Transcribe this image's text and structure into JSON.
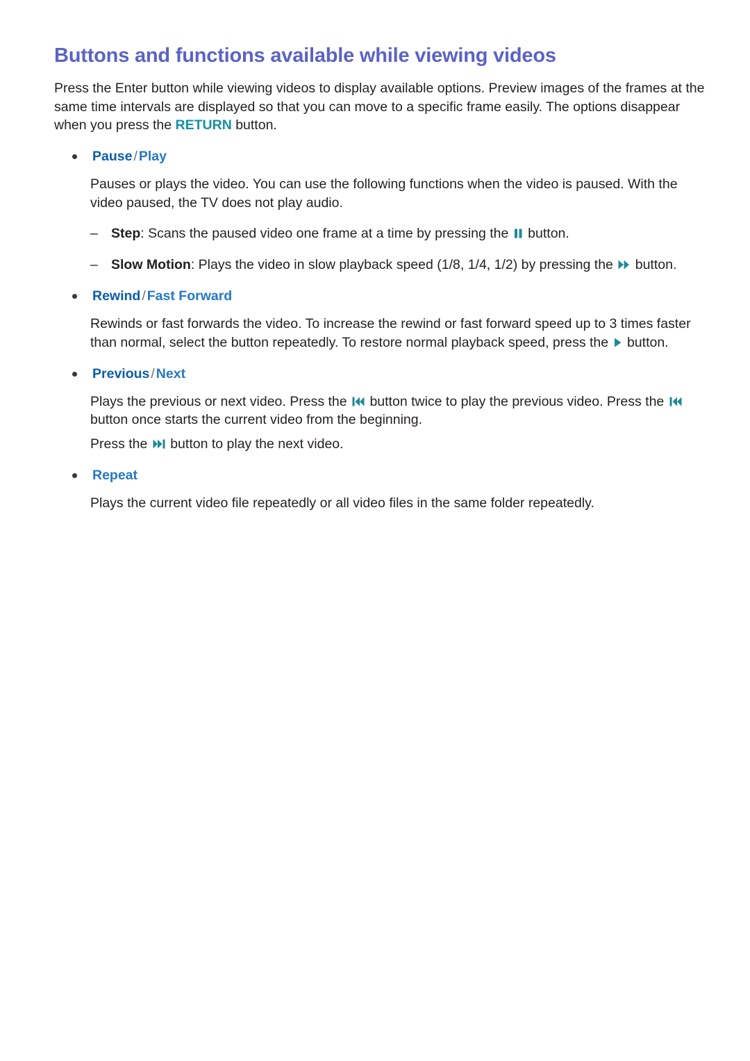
{
  "colors": {
    "title": "#5b63c4",
    "heading_strong": "#0b5ea8",
    "heading_light": "#2579c4",
    "keyword_teal": "#1591a5",
    "icon_teal": "#1e8a96",
    "body": "#231f20"
  },
  "title": "Buttons and functions available while viewing videos",
  "intro": {
    "part1": "Press the Enter button while viewing videos to display available options. Preview images of the frames at the same time intervals are displayed so that you can move to a specific frame easily. The options disappear when you press the ",
    "keyword": "RETURN",
    "part2": " button."
  },
  "sections": [
    {
      "id": "pause-play",
      "heading": {
        "primary": "Pause",
        "separator": "/",
        "secondary": "Play"
      },
      "body": "Pauses or plays the video. You can use the following functions when the video is paused. With the video paused, the TV does not play audio.",
      "sub_items": [
        {
          "id": "step",
          "dash": "–",
          "label": "Step",
          "text_before": ": Scans the paused video one frame at a time by pressing the ",
          "icon": "pause-icon",
          "text_after": " button."
        },
        {
          "id": "slow-motion",
          "dash": "–",
          "label": "Slow Motion",
          "text_before": ": Plays the video in slow playback speed (1/8, 1/4, 1/2) by pressing the ",
          "icon": "fast-forward-icon",
          "text_after": " button."
        }
      ]
    },
    {
      "id": "rewind-fast-forward",
      "heading": {
        "primary": "Rewind",
        "separator": "/",
        "secondary": "Fast Forward"
      },
      "body_before": "Rewinds or fast forwards the video. To increase the rewind or fast forward speed up to 3 times faster than normal, select the button repeatedly. To restore normal playback speed, press the ",
      "icon": "play-icon",
      "body_after": " button."
    },
    {
      "id": "previous-next",
      "heading": {
        "primary": "Previous",
        "separator": "/",
        "secondary": "Next"
      },
      "body_p1_a": "Plays the previous or next video. Press the ",
      "body_p1_icon1": "skip-back-icon",
      "body_p1_b": " button twice to play the previous video. Press the ",
      "body_p1_icon2": "skip-back-icon",
      "body_p1_c": " button once starts the current video from the beginning.",
      "body_p2_a": "Press the ",
      "body_p2_icon": "skip-forward-icon",
      "body_p2_b": " button to play the next video."
    },
    {
      "id": "repeat",
      "heading": {
        "primary": "Repeat",
        "separator": "",
        "secondary": ""
      },
      "body": "Plays the current video file repeatedly or all video files in the same folder repeatedly."
    }
  ]
}
